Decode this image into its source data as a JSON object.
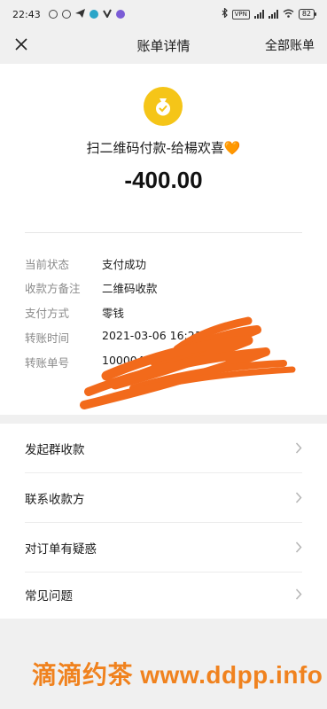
{
  "status_bar": {
    "time": "22:43",
    "vpn": "VPN",
    "battery": "82"
  },
  "header": {
    "title": "账单详情",
    "right_link": "全部账单"
  },
  "transaction": {
    "title": "扫二维码付款-给楊欢喜",
    "heart": "🧡",
    "amount": "-400.00",
    "icon": "money-bag-check-icon",
    "icon_color": "#f5c518"
  },
  "details": [
    {
      "label": "当前状态",
      "value": "支付成功"
    },
    {
      "label": "收款方备注",
      "value": "二维码收款"
    },
    {
      "label": "支付方式",
      "value": "零钱"
    },
    {
      "label": "转账时间",
      "value": "2021-03-06 16:21:1"
    },
    {
      "label": "转账单号",
      "value": "10000490"
    }
  ],
  "actions": [
    {
      "label": "发起群收款"
    },
    {
      "label": "联系收款方"
    },
    {
      "label": "对订单有疑惑"
    },
    {
      "label": "常见问题"
    }
  ],
  "watermark": "滴滴约茶 www.ddpp.info",
  "colors": {
    "accent": "#f5c518",
    "scribble": "#f26a1b",
    "watermark": "#f0821e"
  }
}
